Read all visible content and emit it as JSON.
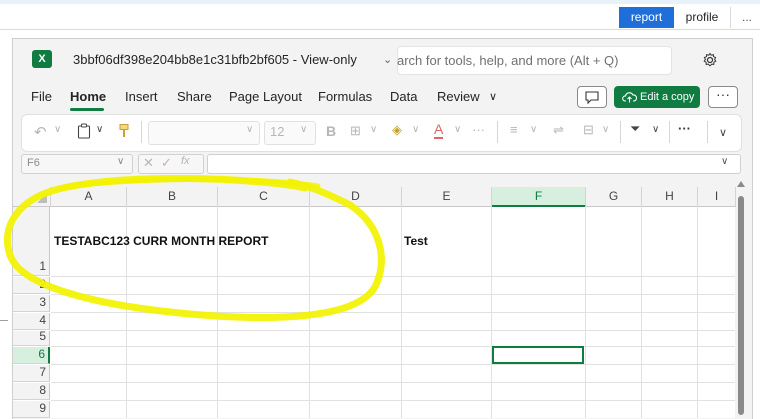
{
  "host": {
    "tabs": [
      {
        "label": "report",
        "active": true
      },
      {
        "label": "profile",
        "active": false
      },
      {
        "label": "...",
        "active": false
      }
    ]
  },
  "excel": {
    "file_name": "3bbf06df398e204bb8e1c31bfb2bf605",
    "mode_label": "View-only",
    "search_placeholder": "Search for tools, help, and more (Alt + Q)",
    "search_visible_text": "arch for tools, help, and more (Alt + Q)",
    "menu": [
      "File",
      "Home",
      "Insert",
      "Share",
      "Page Layout",
      "Formulas",
      "Data",
      "Review"
    ],
    "active_menu": "Home",
    "edit_copy_label": "Edit a copy",
    "font_size": "12",
    "name_box": "F6",
    "fx_label": "fx",
    "accent_color": "#107c41"
  },
  "sheet": {
    "columns": [
      "A",
      "B",
      "C",
      "D",
      "E",
      "F",
      "G",
      "H",
      "I"
    ],
    "selected_column": "F",
    "rows": [
      "1",
      "2",
      "3",
      "4",
      "5",
      "6",
      "7",
      "8",
      "9"
    ],
    "selected_row": "6",
    "cells": {
      "A1": "TESTABC123 CURR MONTH REPORT",
      "E1": "Test"
    },
    "active_cell": "F6"
  },
  "annotation": {
    "color": "#f5f500",
    "shape": "hand-drawn ellipse around A1"
  }
}
